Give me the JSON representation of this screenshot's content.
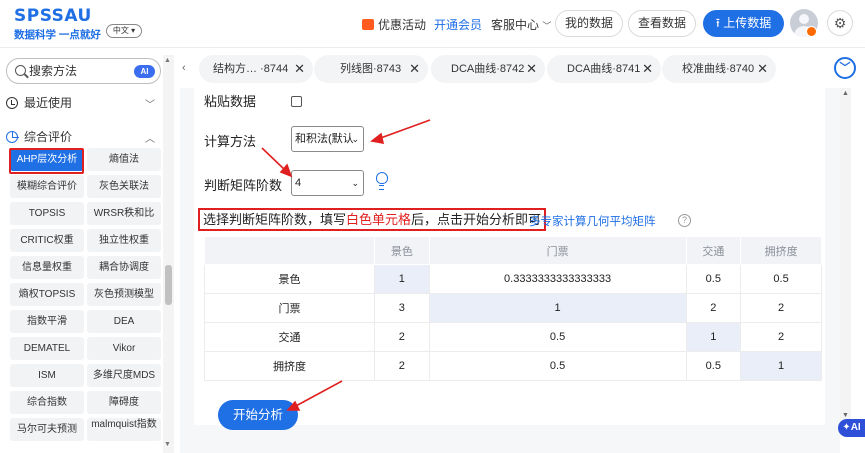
{
  "header": {
    "logo_main": "SPSSAU",
    "logo_sub": "数据科学 一点就好",
    "lang": "中文",
    "promo": "优惠活动",
    "member": "开通会员",
    "service": "客服中心",
    "my_data": "我的数据",
    "view_data": "查看数据",
    "upload": "上传数据"
  },
  "sidebar": {
    "search_placeholder": "搜索方法",
    "ai_badge": "AI",
    "recent_label": "最近使用",
    "category_label": "综合评价",
    "methods": [
      "AHP层次分析",
      "熵值法",
      "模糊综合评价",
      "灰色关联法",
      "TOPSIS",
      "WRSR秩和比",
      "CRITIC权重",
      "独立性权重",
      "信息量权重",
      "耦合协调度",
      "熵权TOPSIS",
      "灰色预测模型",
      "指数平滑",
      "DEA",
      "DEMATEL",
      "Vikor",
      "ISM",
      "多维尺度MDS",
      "综合指数",
      "障碍度",
      "马尔可夫预测",
      "malmquist指数"
    ]
  },
  "tabs": [
    "结构方… ·8744",
    "列线图·8743",
    "DCA曲线·8742",
    "DCA曲线·8741",
    "校准曲线·8740"
  ],
  "form": {
    "paste_label": "粘贴数据",
    "method_label": "计算方法",
    "method_value": "和积法(默认",
    "order_label": "判断矩阵阶数",
    "order_value": "4",
    "instruction_a": "选择判断矩阵阶数，填写",
    "instruction_hl": "白色单元格",
    "instruction_b": "后，点击开始分析即可",
    "expert_link": "多专家计算几何平均矩阵",
    "help": "?",
    "start_button": "开始分析"
  },
  "matrix": {
    "columns": [
      "景色",
      "门票",
      "交通",
      "拥挤度"
    ],
    "rows": [
      {
        "name": "景色",
        "values": [
          "1",
          "0.3333333333333333",
          "0.5",
          "0.5"
        ]
      },
      {
        "name": "门票",
        "values": [
          "3",
          "1",
          "2",
          "2"
        ]
      },
      {
        "name": "交通",
        "values": [
          "2",
          "0.5",
          "1",
          "2"
        ]
      },
      {
        "name": "拥挤度",
        "values": [
          "2",
          "0.5",
          "0.5",
          "1"
        ]
      }
    ]
  },
  "misc": {
    "ai_float": "AI",
    "accent_color": "#1f6fe5",
    "highlight_color": "#e02020"
  }
}
